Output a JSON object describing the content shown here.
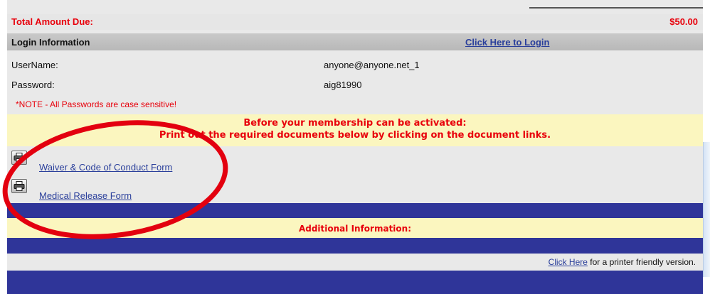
{
  "total": {
    "label": "Total Amount Due:",
    "value": "$50.00"
  },
  "login": {
    "header": "Login Information",
    "login_link": "Click Here to Login",
    "username_label": "UserName:",
    "username_value": "anyone@anyone.net_1",
    "password_label": "Password:",
    "password_value": "aig81990",
    "note": "*NOTE - All Passwords are case sensitive!"
  },
  "notice": {
    "line1": "Before your membership can be activated:",
    "line2": "Print out the required documents below by clicking on the document links."
  },
  "documents": [
    {
      "label": "Waiver & Code of Conduct Form",
      "icon": "printer-icon"
    },
    {
      "label": "Medical Release Form",
      "icon": "printer-icon"
    }
  ],
  "additional": {
    "label": "Additional Information:"
  },
  "printer_friendly": {
    "link": "Click Here",
    "text": " for a printer friendly version."
  },
  "colors": {
    "accent_red": "#e8000b",
    "banner_blue": "#2f3599",
    "notice_yellow": "#fbf6bf",
    "annotation_red": "#e3000f"
  }
}
